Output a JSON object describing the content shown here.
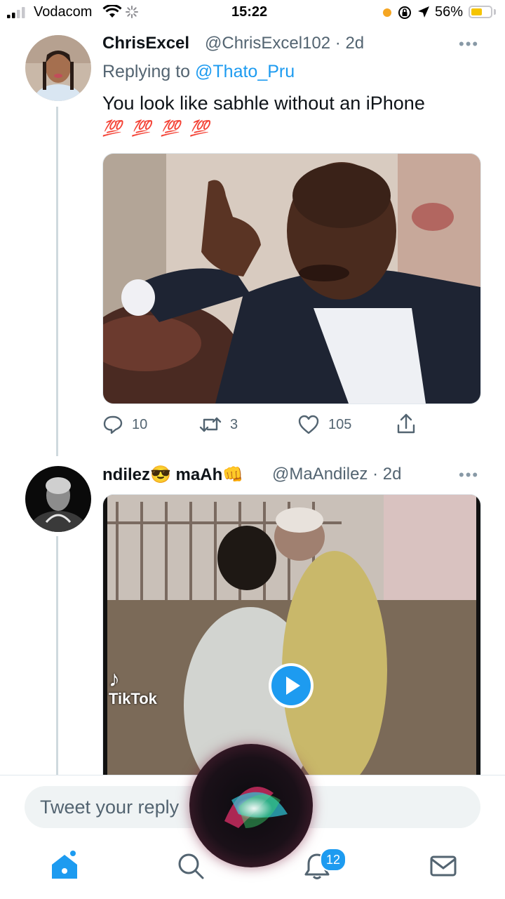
{
  "status_bar": {
    "carrier": "Vodacom",
    "time": "15:22",
    "battery": "56%",
    "battery_level": 0.56
  },
  "tweets": [
    {
      "name": "ChrisExcel",
      "handle": "@ChrisExcel102",
      "time": "2d",
      "replying_prefix": "Replying to",
      "replying_to": "@Thato_Pru",
      "text": "You look like sabhle without an iPhone",
      "emoji_line": "💯 💯 💯 💯",
      "replies": "10",
      "retweets": "3",
      "likes": "105"
    },
    {
      "name": "ndilez😎 maAh👊",
      "handle": "@MaAndilez",
      "time": "2d",
      "video_watermark": "TikTok"
    }
  ],
  "composer": {
    "placeholder": "Tweet your reply"
  },
  "tab_bar": {
    "notifications_badge": "12"
  },
  "colors": {
    "accent": "#1d9bf0",
    "text": "#0f1419",
    "secondary": "#536471",
    "thread_line": "#cfd9de"
  }
}
